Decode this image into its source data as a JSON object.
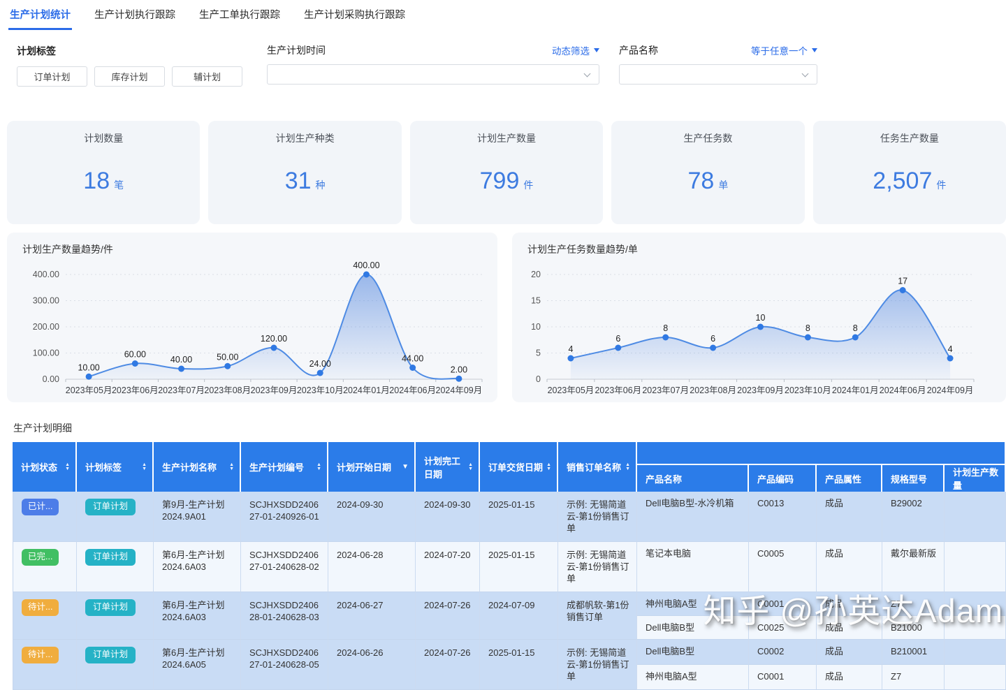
{
  "tabs": [
    {
      "label": "生产计划统计",
      "active": true
    },
    {
      "label": "生产计划执行跟踪",
      "active": false
    },
    {
      "label": "生产工单执行跟踪",
      "active": false
    },
    {
      "label": "生产计划采购执行跟踪",
      "active": false
    }
  ],
  "filters": {
    "plan_tag_label": "计划标签",
    "plan_tags": [
      "订单计划",
      "库存计划",
      "辅计划"
    ],
    "time_label": "生产计划时间",
    "time_filter_mode": "动态筛选",
    "product_label": "产品名称",
    "product_filter_mode": "等于任意一个"
  },
  "stat_cards": [
    {
      "title": "计划数量",
      "value": "18",
      "unit": "笔"
    },
    {
      "title": "计划生产种类",
      "value": "31",
      "unit": "种"
    },
    {
      "title": "计划生产数量",
      "value": "799",
      "unit": "件"
    },
    {
      "title": "生产任务数",
      "value": "78",
      "unit": "单"
    },
    {
      "title": "任务生产数量",
      "value": "2,507",
      "unit": "件"
    }
  ],
  "chart_data": [
    {
      "type": "area",
      "title": "计划生产数量趋势/件",
      "categories": [
        "2023年05月",
        "2023年06月",
        "2023年07月",
        "2023年08月",
        "2023年09月",
        "2023年10月",
        "2024年01月",
        "2024年06月",
        "2024年09月"
      ],
      "values": [
        10,
        60,
        40,
        50,
        120,
        24,
        400,
        44,
        2
      ],
      "value_labels": [
        "10.00",
        "60.00",
        "40.00",
        "50.00",
        "120.00",
        "24.00",
        "400.00",
        "44.00",
        "2.00"
      ],
      "ylim": [
        0,
        400
      ],
      "yticks": [
        0,
        100,
        200,
        300,
        400
      ],
      "ytick_labels": [
        "0.00",
        "100.00",
        "200.00",
        "300.00",
        "400.00"
      ],
      "xlabel": "",
      "ylabel": "",
      "grid": true,
      "legend": false
    },
    {
      "type": "area",
      "title": "计划生产任务数量趋势/单",
      "categories": [
        "2023年05月",
        "2023年06月",
        "2023年07月",
        "2023年08月",
        "2023年09月",
        "2023年10月",
        "2024年01月",
        "2024年06月",
        "2024年09月"
      ],
      "values": [
        4,
        6,
        8,
        6,
        10,
        8,
        8,
        17,
        4
      ],
      "value_labels": [
        "4",
        "6",
        "8",
        "6",
        "10",
        "8",
        "8",
        "17",
        "4"
      ],
      "ylim": [
        0,
        20
      ],
      "yticks": [
        0,
        5,
        10,
        15,
        20
      ],
      "ytick_labels": [
        "0",
        "5",
        "10",
        "15",
        "20"
      ],
      "xlabel": "",
      "ylabel": "",
      "grid": true,
      "legend": false
    }
  ],
  "table": {
    "title": "生产计划明细",
    "columns": [
      {
        "label": "计划状态",
        "sort": "both"
      },
      {
        "label": "计划标签",
        "sort": "both"
      },
      {
        "label": "生产计划名称",
        "sort": "both"
      },
      {
        "label": "生产计划编号",
        "sort": "both"
      },
      {
        "label": "计划开始日期",
        "sort": "desc"
      },
      {
        "label": "计划完工日期",
        "sort": "both"
      },
      {
        "label": "订单交货日期",
        "sort": "both"
      },
      {
        "label": "销售订单名称",
        "sort": "both"
      }
    ],
    "product_columns": [
      "产品名称",
      "产品编码",
      "产品属性",
      "规格型号",
      "计划生产数量"
    ],
    "rows": [
      {
        "status": {
          "label": "已计...",
          "type": "planned"
        },
        "tag": "订单计划",
        "plan_name": "第9月-生产计划 2024.9A01",
        "plan_code": "SCJHXSDD240627-01-240926-01",
        "start_date": "2024-09-30",
        "finish_date": "2024-09-30",
        "delivery_date": "2025-01-15",
        "sales_order": "示例: 无锡简道云-第1份销售订单",
        "products": [
          {
            "name": "Dell电脑B型-水冷机箱",
            "code": "C0013",
            "attr": "成品",
            "spec": "B29002",
            "qty": ""
          }
        ]
      },
      {
        "status": {
          "label": "已完...",
          "type": "done"
        },
        "tag": "订单计划",
        "plan_name": "第6月-生产计划 2024.6A03",
        "plan_code": "SCJHXSDD240627-01-240628-02",
        "start_date": "2024-06-28",
        "finish_date": "2024-07-20",
        "delivery_date": "2025-01-15",
        "sales_order": "示例: 无锡简道云-第1份销售订单",
        "products": [
          {
            "name": "笔记本电脑",
            "code": "C0005",
            "attr": "成品",
            "spec": "戴尔最新版",
            "qty": ""
          }
        ]
      },
      {
        "status": {
          "label": "待计...",
          "type": "pending"
        },
        "tag": "订单计划",
        "plan_name": "第6月-生产计划 2024.6A03",
        "plan_code": "SCJHXSDD240628-01-240628-03",
        "start_date": "2024-06-27",
        "finish_date": "2024-07-26",
        "delivery_date": "2024-07-09",
        "sales_order": "成都帆软-第1份销售订单",
        "products": [
          {
            "name": "神州电脑A型",
            "code": "C0001",
            "attr": "成品",
            "spec": "Z7",
            "qty": ""
          },
          {
            "name": "Dell电脑B型",
            "code": "C0025",
            "attr": "成品",
            "spec": "B21000",
            "qty": ""
          }
        ]
      },
      {
        "status": {
          "label": "待计...",
          "type": "pending"
        },
        "tag": "订单计划",
        "plan_name": "第6月-生产计划 2024.6A05",
        "plan_code": "SCJHXSDD240627-01-240628-05",
        "start_date": "2024-06-26",
        "finish_date": "2024-07-26",
        "delivery_date": "2025-01-15",
        "sales_order": "示例: 无锡简道云-第1份销售订单",
        "products": [
          {
            "name": "Dell电脑B型",
            "code": "C0002",
            "attr": "成品",
            "spec": "B210001",
            "qty": ""
          },
          {
            "name": "神州电脑A型",
            "code": "C0001",
            "attr": "成品",
            "spec": "Z7",
            "qty": ""
          }
        ]
      }
    ]
  },
  "watermark": "知乎 @孙英达Adam",
  "colors": {
    "accent": "#2b6ce8",
    "table_header": "#2b7ce9",
    "row_blue": "#c9dcf5",
    "row_white": "#f2f7fd",
    "status_planned": "#4d7de8",
    "status_done": "#41bf63",
    "status_pending": "#f0ad3e",
    "tag_badge": "#25b2c6",
    "stat_number": "#3d7be0",
    "chart_line": "#4e8be4"
  }
}
